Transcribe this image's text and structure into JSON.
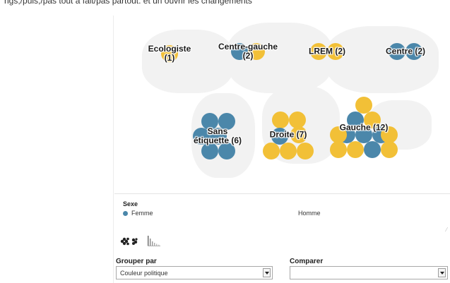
{
  "header_cut_text": "ngs,/puis,/pas tout à fait/pas partout. et un ouvrir les changements",
  "colors": {
    "femme": "#4b87aa",
    "homme": "#f2c037"
  },
  "groups": [
    {
      "label": "Ecologiste\n(1)",
      "femme": 0,
      "homme": 1
    },
    {
      "label": "Centre-gauche\n(2)",
      "femme": 1,
      "homme": 1
    },
    {
      "label": "LREM (2)",
      "femme": 0,
      "homme": 2
    },
    {
      "label": "Centre (2)",
      "femme": 2,
      "homme": 0
    },
    {
      "label": "Sans\nétiquette (6)",
      "femme": 6,
      "homme": 0
    },
    {
      "label": "Droite (7)",
      "femme": 1,
      "homme": 6
    },
    {
      "label": "Gauche (12)",
      "femme": 5,
      "homme": 7
    }
  ],
  "legend": {
    "title": "Sexe",
    "femme": "Femme",
    "homme": "Homme"
  },
  "view_icons": [
    "bubble-cluster-icon",
    "bar-chart-icon"
  ],
  "controls": {
    "group_by_label": "Grouper par",
    "group_by_value": "Couleur politique",
    "compare_label": "Comparer",
    "compare_value": ""
  }
}
